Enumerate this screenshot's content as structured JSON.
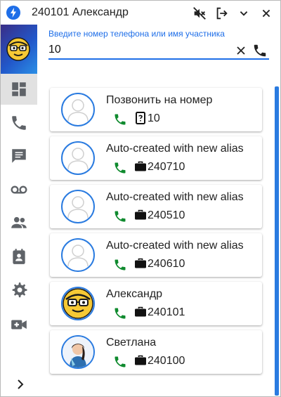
{
  "window": {
    "title": "240101 Александр"
  },
  "titlebar_buttons": {
    "mute_icon": "volume-off-icon",
    "logout_icon": "logout-icon",
    "minimize_icon": "chevron-down-icon",
    "close_icon": "close-icon"
  },
  "sidebar": {
    "items": [
      {
        "icon": "dashboard-icon",
        "active": true
      },
      {
        "icon": "phone-icon",
        "active": false
      },
      {
        "icon": "chat-icon",
        "active": false
      },
      {
        "icon": "voicemail-icon",
        "active": false
      },
      {
        "icon": "people-icon",
        "active": false
      },
      {
        "icon": "contacts-icon",
        "active": false
      },
      {
        "icon": "gear-icon",
        "active": false
      },
      {
        "icon": "video-add-icon",
        "active": false
      }
    ],
    "expand_icon": "chevron-right-icon"
  },
  "search": {
    "label": "Введите номер телефона или имя участника",
    "value": "10"
  },
  "results": [
    {
      "name": "Позвонить на номер",
      "number": "10",
      "kind_icon": "unknown-number-icon",
      "avatar": "placeholder"
    },
    {
      "name": "Auto-created with new alias",
      "number": "240710",
      "kind_icon": "work-icon",
      "avatar": "placeholder"
    },
    {
      "name": "Auto-created with new alias",
      "number": "240510",
      "kind_icon": "work-icon",
      "avatar": "placeholder"
    },
    {
      "name": "Auto-created with new alias",
      "number": "240610",
      "kind_icon": "work-icon",
      "avatar": "placeholder"
    },
    {
      "name": "Александр",
      "number": "240101",
      "kind_icon": "work-icon",
      "avatar": "emoji-glasses"
    },
    {
      "name": "Светлана",
      "number": "240100",
      "kind_icon": "work-icon",
      "avatar": "photo"
    }
  ],
  "colors": {
    "accent": "#1e6ee8",
    "call_green": "#0f8a2e",
    "icon_grey": "#5f6368"
  }
}
